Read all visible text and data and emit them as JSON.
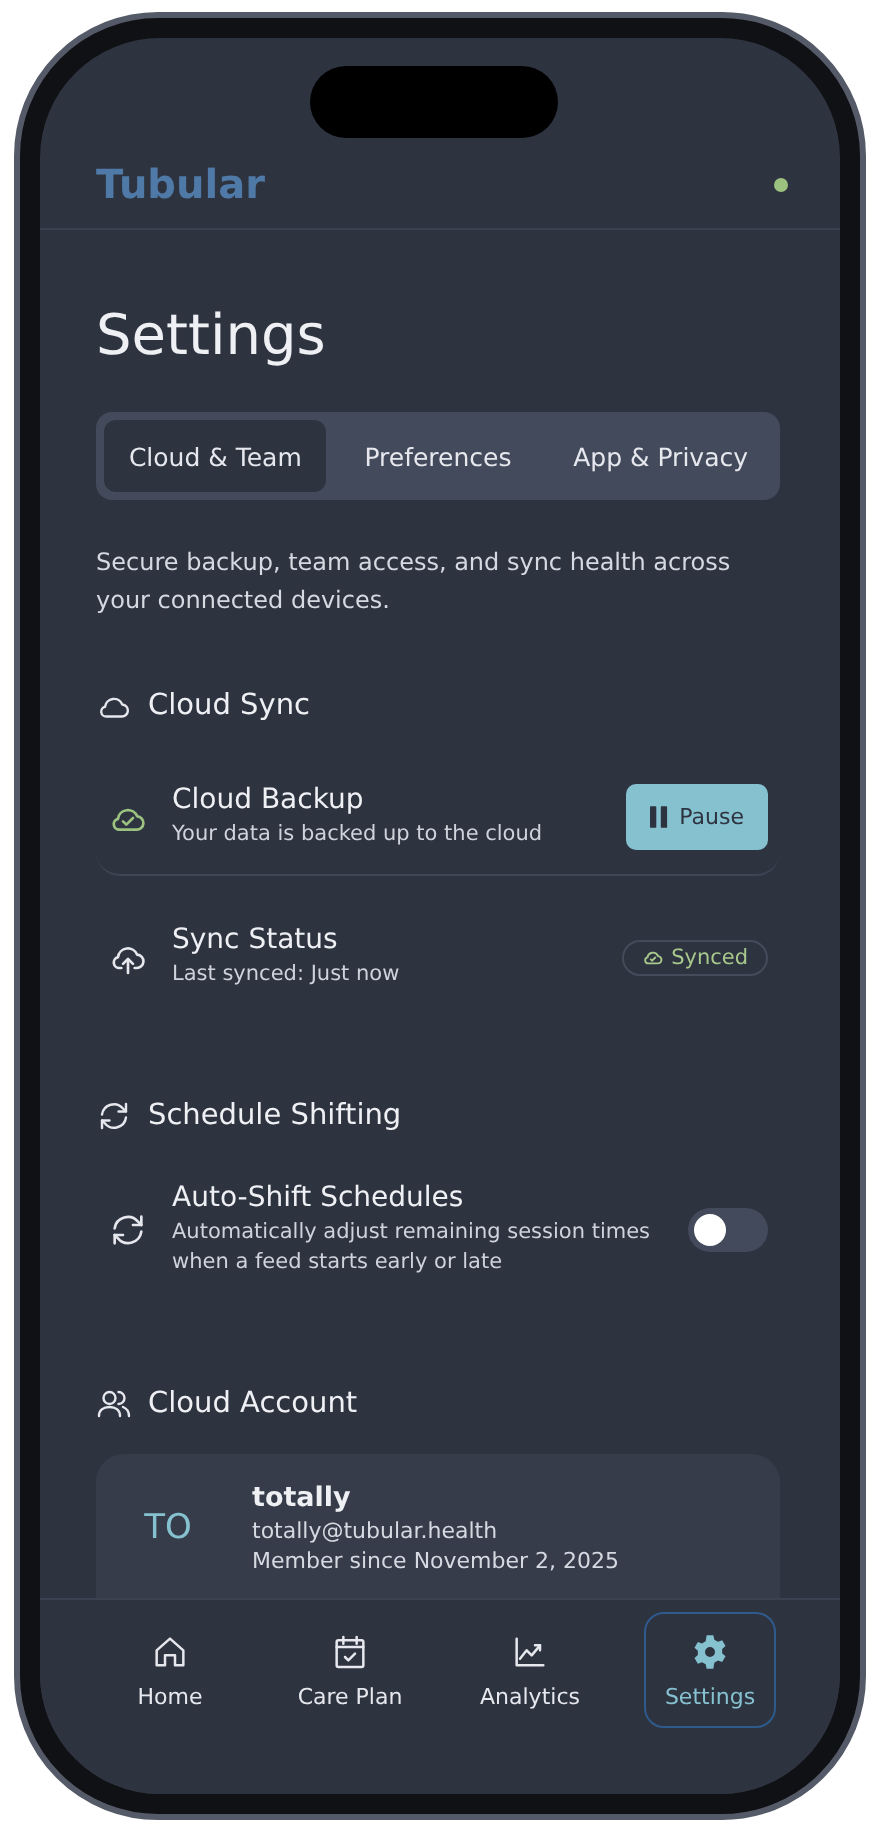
{
  "app": {
    "logo": "Tubular"
  },
  "page": {
    "title": "Settings",
    "description": "Secure backup, team access, and sync health across your connected devices."
  },
  "tabs": [
    {
      "label": "Cloud & Team",
      "selected": true
    },
    {
      "label": "Preferences",
      "selected": false
    },
    {
      "label": "App & Privacy",
      "selected": false
    }
  ],
  "sections": [
    {
      "title": "Cloud Sync",
      "items": [
        {
          "kind": "button",
          "title": "Cloud Backup",
          "subtitle": "Your data is backed up to the cloud",
          "action": "Pause"
        },
        {
          "kind": "badge",
          "title": "Sync Status",
          "subtitle": "Last synced: Just now",
          "badge": "Synced"
        }
      ]
    },
    {
      "title": "Schedule Shifting",
      "items": [
        {
          "kind": "toggle",
          "title": "Auto-Shift Schedules",
          "subtitle": "Automatically adjust remaining session times when a feed starts early or late",
          "on": false
        }
      ]
    },
    {
      "title": "Cloud Account",
      "account": {
        "initials": "TO",
        "name": "totally",
        "email": "totally@tubular.health",
        "member_since": "Member since November 2, 2025"
      }
    }
  ],
  "nav": [
    {
      "label": "Home",
      "selected": false
    },
    {
      "label": "Care Plan",
      "selected": false
    },
    {
      "label": "Analytics",
      "selected": false
    },
    {
      "label": "Settings",
      "selected": true
    }
  ]
}
